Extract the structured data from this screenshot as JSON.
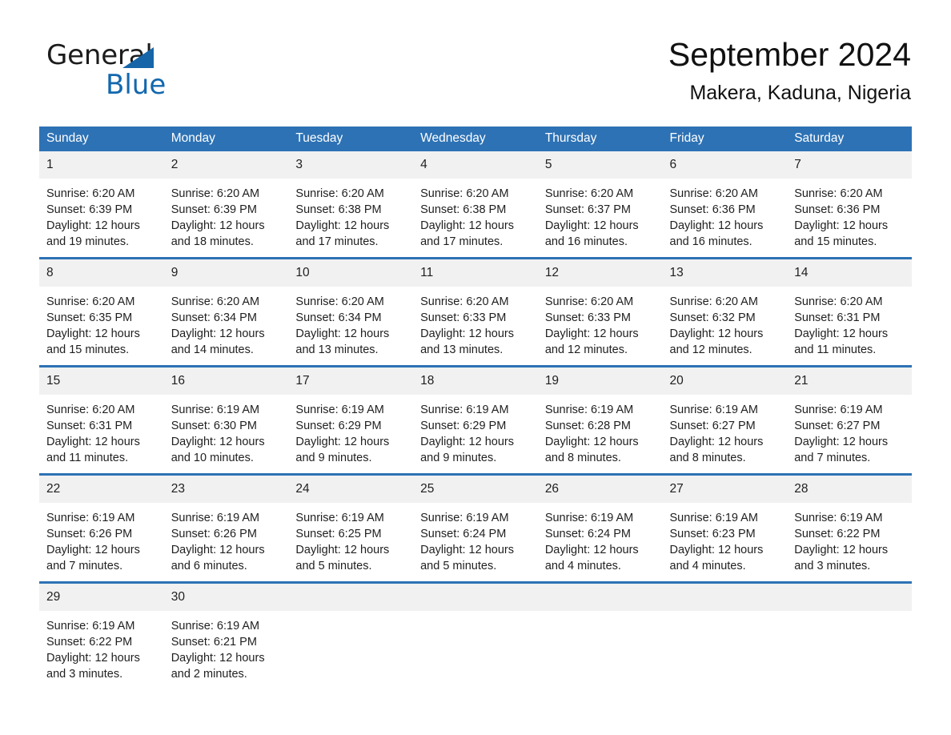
{
  "brand": {
    "name_part1": "General",
    "name_part2": "Blue",
    "accent_color": "#1268ae"
  },
  "header": {
    "month_title": "September 2024",
    "location": "Makera, Kaduna, Nigeria"
  },
  "theme": {
    "header_blue": "#2d72b5",
    "daynum_gray": "#f1f1f1"
  },
  "weekdays": [
    "Sunday",
    "Monday",
    "Tuesday",
    "Wednesday",
    "Thursday",
    "Friday",
    "Saturday"
  ],
  "weeks": [
    [
      {
        "day": "1",
        "sunrise": "Sunrise: 6:20 AM",
        "sunset": "Sunset: 6:39 PM",
        "daylight": "Daylight: 12 hours and 19 minutes."
      },
      {
        "day": "2",
        "sunrise": "Sunrise: 6:20 AM",
        "sunset": "Sunset: 6:39 PM",
        "daylight": "Daylight: 12 hours and 18 minutes."
      },
      {
        "day": "3",
        "sunrise": "Sunrise: 6:20 AM",
        "sunset": "Sunset: 6:38 PM",
        "daylight": "Daylight: 12 hours and 17 minutes."
      },
      {
        "day": "4",
        "sunrise": "Sunrise: 6:20 AM",
        "sunset": "Sunset: 6:38 PM",
        "daylight": "Daylight: 12 hours and 17 minutes."
      },
      {
        "day": "5",
        "sunrise": "Sunrise: 6:20 AM",
        "sunset": "Sunset: 6:37 PM",
        "daylight": "Daylight: 12 hours and 16 minutes."
      },
      {
        "day": "6",
        "sunrise": "Sunrise: 6:20 AM",
        "sunset": "Sunset: 6:36 PM",
        "daylight": "Daylight: 12 hours and 16 minutes."
      },
      {
        "day": "7",
        "sunrise": "Sunrise: 6:20 AM",
        "sunset": "Sunset: 6:36 PM",
        "daylight": "Daylight: 12 hours and 15 minutes."
      }
    ],
    [
      {
        "day": "8",
        "sunrise": "Sunrise: 6:20 AM",
        "sunset": "Sunset: 6:35 PM",
        "daylight": "Daylight: 12 hours and 15 minutes."
      },
      {
        "day": "9",
        "sunrise": "Sunrise: 6:20 AM",
        "sunset": "Sunset: 6:34 PM",
        "daylight": "Daylight: 12 hours and 14 minutes."
      },
      {
        "day": "10",
        "sunrise": "Sunrise: 6:20 AM",
        "sunset": "Sunset: 6:34 PM",
        "daylight": "Daylight: 12 hours and 13 minutes."
      },
      {
        "day": "11",
        "sunrise": "Sunrise: 6:20 AM",
        "sunset": "Sunset: 6:33 PM",
        "daylight": "Daylight: 12 hours and 13 minutes."
      },
      {
        "day": "12",
        "sunrise": "Sunrise: 6:20 AM",
        "sunset": "Sunset: 6:33 PM",
        "daylight": "Daylight: 12 hours and 12 minutes."
      },
      {
        "day": "13",
        "sunrise": "Sunrise: 6:20 AM",
        "sunset": "Sunset: 6:32 PM",
        "daylight": "Daylight: 12 hours and 12 minutes."
      },
      {
        "day": "14",
        "sunrise": "Sunrise: 6:20 AM",
        "sunset": "Sunset: 6:31 PM",
        "daylight": "Daylight: 12 hours and 11 minutes."
      }
    ],
    [
      {
        "day": "15",
        "sunrise": "Sunrise: 6:20 AM",
        "sunset": "Sunset: 6:31 PM",
        "daylight": "Daylight: 12 hours and 11 minutes."
      },
      {
        "day": "16",
        "sunrise": "Sunrise: 6:19 AM",
        "sunset": "Sunset: 6:30 PM",
        "daylight": "Daylight: 12 hours and 10 minutes."
      },
      {
        "day": "17",
        "sunrise": "Sunrise: 6:19 AM",
        "sunset": "Sunset: 6:29 PM",
        "daylight": "Daylight: 12 hours and 9 minutes."
      },
      {
        "day": "18",
        "sunrise": "Sunrise: 6:19 AM",
        "sunset": "Sunset: 6:29 PM",
        "daylight": "Daylight: 12 hours and 9 minutes."
      },
      {
        "day": "19",
        "sunrise": "Sunrise: 6:19 AM",
        "sunset": "Sunset: 6:28 PM",
        "daylight": "Daylight: 12 hours and 8 minutes."
      },
      {
        "day": "20",
        "sunrise": "Sunrise: 6:19 AM",
        "sunset": "Sunset: 6:27 PM",
        "daylight": "Daylight: 12 hours and 8 minutes."
      },
      {
        "day": "21",
        "sunrise": "Sunrise: 6:19 AM",
        "sunset": "Sunset: 6:27 PM",
        "daylight": "Daylight: 12 hours and 7 minutes."
      }
    ],
    [
      {
        "day": "22",
        "sunrise": "Sunrise: 6:19 AM",
        "sunset": "Sunset: 6:26 PM",
        "daylight": "Daylight: 12 hours and 7 minutes."
      },
      {
        "day": "23",
        "sunrise": "Sunrise: 6:19 AM",
        "sunset": "Sunset: 6:26 PM",
        "daylight": "Daylight: 12 hours and 6 minutes."
      },
      {
        "day": "24",
        "sunrise": "Sunrise: 6:19 AM",
        "sunset": "Sunset: 6:25 PM",
        "daylight": "Daylight: 12 hours and 5 minutes."
      },
      {
        "day": "25",
        "sunrise": "Sunrise: 6:19 AM",
        "sunset": "Sunset: 6:24 PM",
        "daylight": "Daylight: 12 hours and 5 minutes."
      },
      {
        "day": "26",
        "sunrise": "Sunrise: 6:19 AM",
        "sunset": "Sunset: 6:24 PM",
        "daylight": "Daylight: 12 hours and 4 minutes."
      },
      {
        "day": "27",
        "sunrise": "Sunrise: 6:19 AM",
        "sunset": "Sunset: 6:23 PM",
        "daylight": "Daylight: 12 hours and 4 minutes."
      },
      {
        "day": "28",
        "sunrise": "Sunrise: 6:19 AM",
        "sunset": "Sunset: 6:22 PM",
        "daylight": "Daylight: 12 hours and 3 minutes."
      }
    ],
    [
      {
        "day": "29",
        "sunrise": "Sunrise: 6:19 AM",
        "sunset": "Sunset: 6:22 PM",
        "daylight": "Daylight: 12 hours and 3 minutes."
      },
      {
        "day": "30",
        "sunrise": "Sunrise: 6:19 AM",
        "sunset": "Sunset: 6:21 PM",
        "daylight": "Daylight: 12 hours and 2 minutes."
      },
      {
        "day": "",
        "sunrise": "",
        "sunset": "",
        "daylight": ""
      },
      {
        "day": "",
        "sunrise": "",
        "sunset": "",
        "daylight": ""
      },
      {
        "day": "",
        "sunrise": "",
        "sunset": "",
        "daylight": ""
      },
      {
        "day": "",
        "sunrise": "",
        "sunset": "",
        "daylight": ""
      },
      {
        "day": "",
        "sunrise": "",
        "sunset": "",
        "daylight": ""
      }
    ]
  ]
}
